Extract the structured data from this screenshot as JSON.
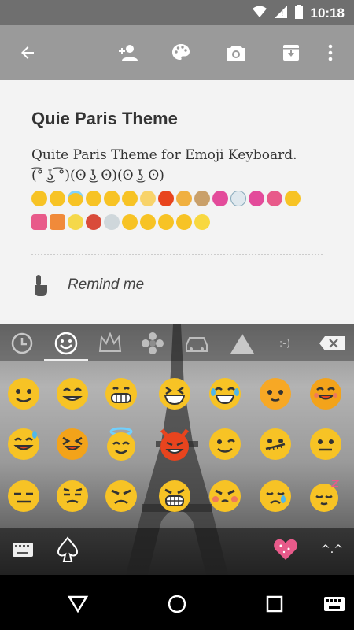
{
  "status_bar": {
    "time": "10:18"
  },
  "theme": {
    "title": "Quie Paris Theme",
    "description_line1": "Quite Paris Theme for Emoji Keyboard.",
    "description_line2": "(͡° ͜ʖ ͡°)(ʘ ͜ʖ ʘ)(ʘ ͜ʖ ʘ)",
    "remind_label": "Remind me"
  },
  "keyboard": {
    "smiley_label": ":-)",
    "more_label": "^.^"
  },
  "colors": {
    "status_bar": "#6f6f6f",
    "toolbar": "#9a9a9a",
    "content_bg": "#f3f3f3",
    "emoji_yellow": "#f7c325",
    "emoji_orange": "#f3a31a",
    "emoji_red": "#e8441e"
  }
}
